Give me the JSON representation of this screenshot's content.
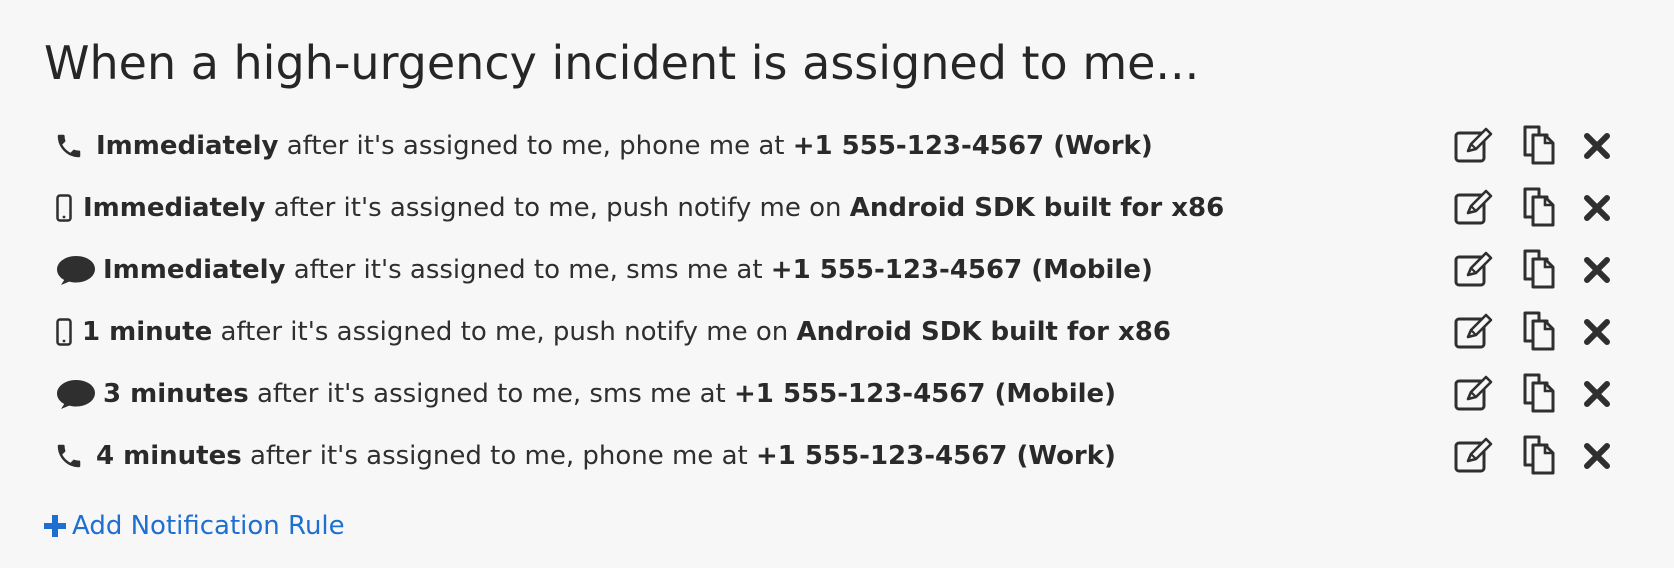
{
  "title": "When a high-urgency incident is assigned to me...",
  "rules": [
    {
      "icon": "phone-icon",
      "delay": "Immediately",
      "middle": " after it's assigned to me, phone me at ",
      "target": "+1 555-123-4567 (Work)"
    },
    {
      "icon": "mobile-device-icon",
      "delay": "Immediately",
      "middle": " after it's assigned to me, push notify me on ",
      "target": "Android SDK built for x86"
    },
    {
      "icon": "sms-bubble-icon",
      "delay": "Immediately",
      "middle": " after it's assigned to me, sms me at ",
      "target": "+1 555-123-4567 (Mobile)"
    },
    {
      "icon": "mobile-device-icon",
      "delay": "1 minute",
      "middle": " after it's assigned to me, push notify me on ",
      "target": "Android SDK built for x86"
    },
    {
      "icon": "sms-bubble-icon",
      "delay": "3 minutes",
      "middle": " after it's assigned to me, sms me at ",
      "target": "+1 555-123-4567 (Mobile)"
    },
    {
      "icon": "phone-icon",
      "delay": "4 minutes",
      "middle": " after it's assigned to me, phone me at ",
      "target": "+1 555-123-4567 (Work)"
    }
  ],
  "add_rule": {
    "label": "Add Notification Rule",
    "color": "#1f6fd1"
  }
}
